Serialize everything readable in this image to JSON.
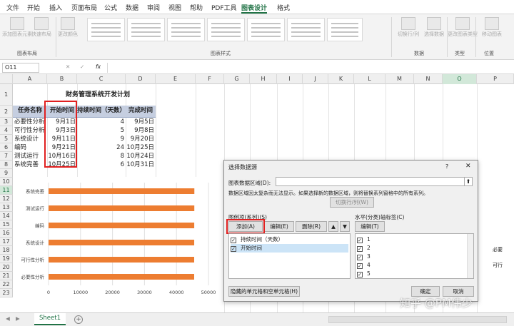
{
  "tabs": [
    "文件",
    "开始",
    "插入",
    "页面布局",
    "公式",
    "数据",
    "审阅",
    "视图",
    "帮助",
    "PDF工具",
    "图表设计",
    "格式"
  ],
  "ribbon": {
    "buttons": [
      {
        "label": "添加图表元素"
      },
      {
        "label": "快速布局"
      },
      {
        "label": "更改颜色"
      },
      {
        "label": "切换行/列"
      },
      {
        "label": "选择数据"
      },
      {
        "label": "更改图表类型"
      },
      {
        "label": "移动图表"
      }
    ],
    "groups": [
      "图表布局",
      "图表样式",
      "数据",
      "类型",
      "位置"
    ]
  },
  "formula": {
    "namebox": "O11",
    "cancel": "✕",
    "enter": "✓",
    "fx": "fx"
  },
  "columns": [
    "A",
    "B",
    "C",
    "D",
    "E",
    "F",
    "G",
    "H",
    "I",
    "J",
    "K",
    "L",
    "M",
    "N",
    "O",
    "P"
  ],
  "rows": [
    "1",
    "2",
    "3",
    "4",
    "5",
    "6",
    "7",
    "8",
    "9",
    "10",
    "11",
    "12",
    "13",
    "14",
    "15",
    "16",
    "17",
    "18",
    "19",
    "20",
    "21",
    "22",
    "23"
  ],
  "sheet": {
    "title": "财务管理系统开发计划",
    "headers": [
      "任务名称",
      "开始时间",
      "持续时间（天数）",
      "完成时间"
    ],
    "data": [
      [
        "必要性分析",
        "9月1日",
        "4",
        "9月5日"
      ],
      [
        "可行性分析",
        "9月3日",
        "5",
        "9月8日"
      ],
      [
        "系统设计",
        "9月11日",
        "9",
        "9月20日"
      ],
      [
        "编码",
        "9月21日",
        "24",
        "10月25日"
      ],
      [
        "测试运行",
        "10月16日",
        "8",
        "10月24日"
      ],
      [
        "系统完善",
        "10月25日",
        "6",
        "10月31日"
      ]
    ]
  },
  "chart_data": {
    "type": "bar",
    "orientation": "horizontal",
    "categories": [
      "系统完善",
      "测试运行",
      "编码",
      "系统设计",
      "可行性分析",
      "必要性分析"
    ],
    "series": [
      {
        "values": [
          45590,
          45580,
          45555,
          45545,
          45537,
          45535
        ]
      }
    ],
    "xlim": [
      0,
      50000
    ],
    "xticks": [
      "0",
      "10000",
      "20000",
      "30000",
      "40000",
      "50000"
    ],
    "grid": true
  },
  "dialog": {
    "title": "选择数据源",
    "help": "?",
    "close": "✕",
    "range_label": "图表数据区域(D):",
    "warning": "数据区域因太复杂而无法显示。如果选择新的数据区域，则将替换系列窗格中的所有系列。",
    "switch_label": "切换行/列(W)",
    "legend_label": "图例项(系列)(S)",
    "add": "添加(A)",
    "edit": "编辑(E)",
    "delete": "删除(R)",
    "series": [
      "持续时间（天数）",
      "开始时间"
    ],
    "axis_label": "水平(分类)轴标签(C)",
    "axis_edit": "编辑(T)",
    "axis_items": [
      "1",
      "2",
      "3",
      "4",
      "5"
    ],
    "hidden_btn": "隐藏的单元格和空单元格(H)",
    "ok": "确定",
    "cancel": "取消"
  },
  "sheet_tab": "Sheet1",
  "add_sheet": "+",
  "watermark": "知乎 @PM伟少",
  "right_peek": [
    "必要",
    "可行"
  ],
  "colors": {
    "accent": "#217346",
    "bar": "#ed7d31",
    "header": "#c5cee0",
    "highlight": "#e02020"
  }
}
